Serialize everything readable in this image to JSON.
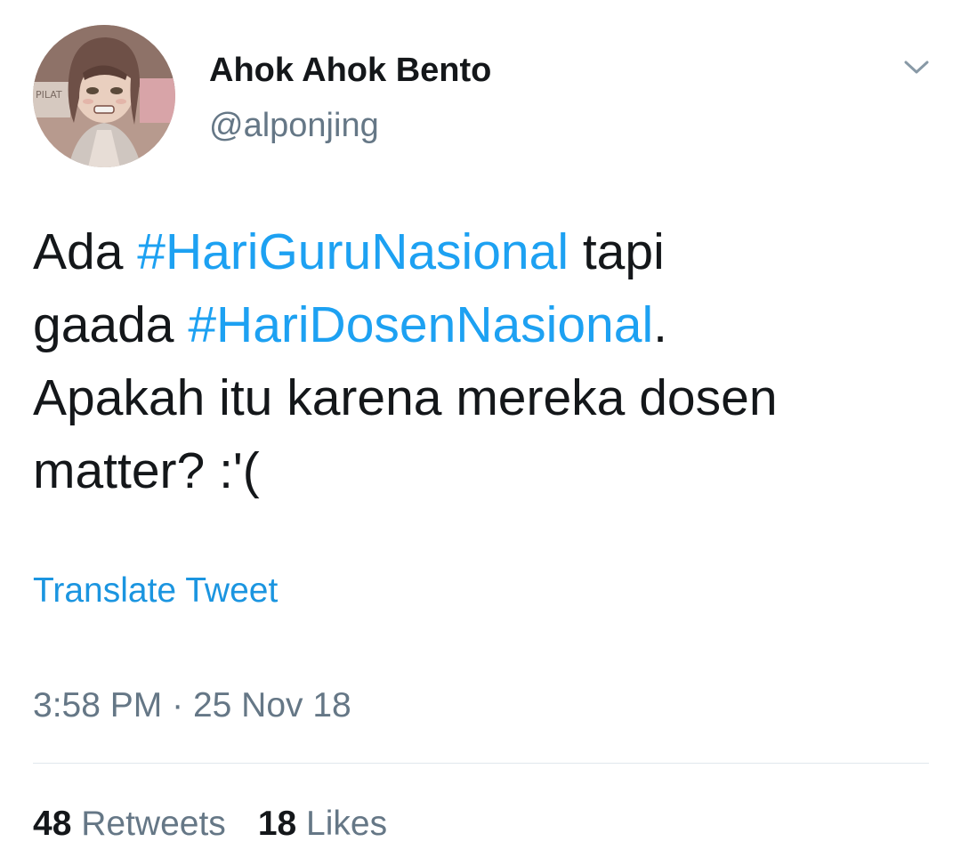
{
  "user": {
    "display_name": "Ahok Ahok Bento",
    "handle": "@alponjing",
    "avatar_sign_text": "PILAT"
  },
  "tweet": {
    "lines": [
      [
        {
          "text": "Ada ",
          "type": "text"
        },
        {
          "text": "#HariGuruNasional",
          "type": "hashtag"
        },
        {
          "text": " tapi",
          "type": "text"
        }
      ],
      [
        {
          "text": "gaada ",
          "type": "text"
        },
        {
          "text": "#HariDosenNasional",
          "type": "hashtag"
        },
        {
          "text": ".",
          "type": "text"
        }
      ],
      [
        {
          "text": "Apakah itu karena mereka dosen",
          "type": "text"
        }
      ],
      [
        {
          "text": "matter? :'(",
          "type": "text"
        }
      ]
    ],
    "translate_label": "Translate Tweet",
    "time": "3:58 PM",
    "separator": "·",
    "date": "25 Nov 18"
  },
  "stats": {
    "retweets_count": "48",
    "retweets_label": "Retweets",
    "likes_count": "18",
    "likes_label": "Likes"
  },
  "icons": {
    "menu": "chevron-down-icon"
  },
  "colors": {
    "hashtag": "#1da1f2",
    "link": "#1b95e0",
    "secondary_text": "#657786",
    "primary_text": "#14171a",
    "divider": "#e1e8ed"
  }
}
